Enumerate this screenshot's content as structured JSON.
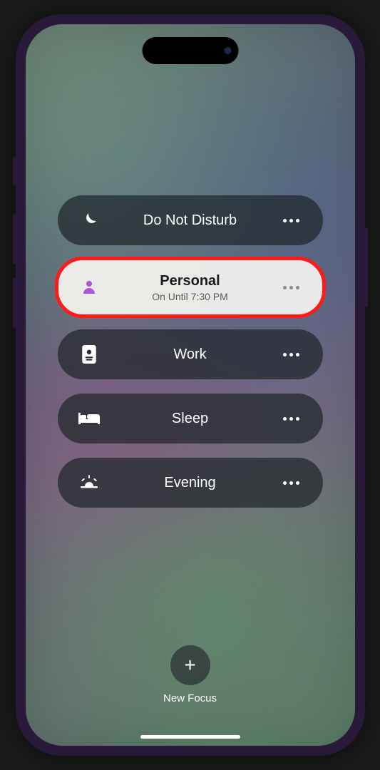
{
  "focus_modes": [
    {
      "id": "dnd",
      "label": "Do Not Disturb",
      "icon": "moon",
      "active": false,
      "subtitle": null
    },
    {
      "id": "personal",
      "label": "Personal",
      "icon": "person",
      "active": true,
      "subtitle": "On Until 7:30 PM",
      "highlighted": true
    },
    {
      "id": "work",
      "label": "Work",
      "icon": "badge",
      "active": false,
      "subtitle": null
    },
    {
      "id": "sleep",
      "label": "Sleep",
      "icon": "bed",
      "active": false,
      "subtitle": null
    },
    {
      "id": "evening",
      "label": "Evening",
      "icon": "sunset",
      "active": false,
      "subtitle": null
    }
  ],
  "new_focus": {
    "label": "New Focus",
    "icon": "+"
  }
}
